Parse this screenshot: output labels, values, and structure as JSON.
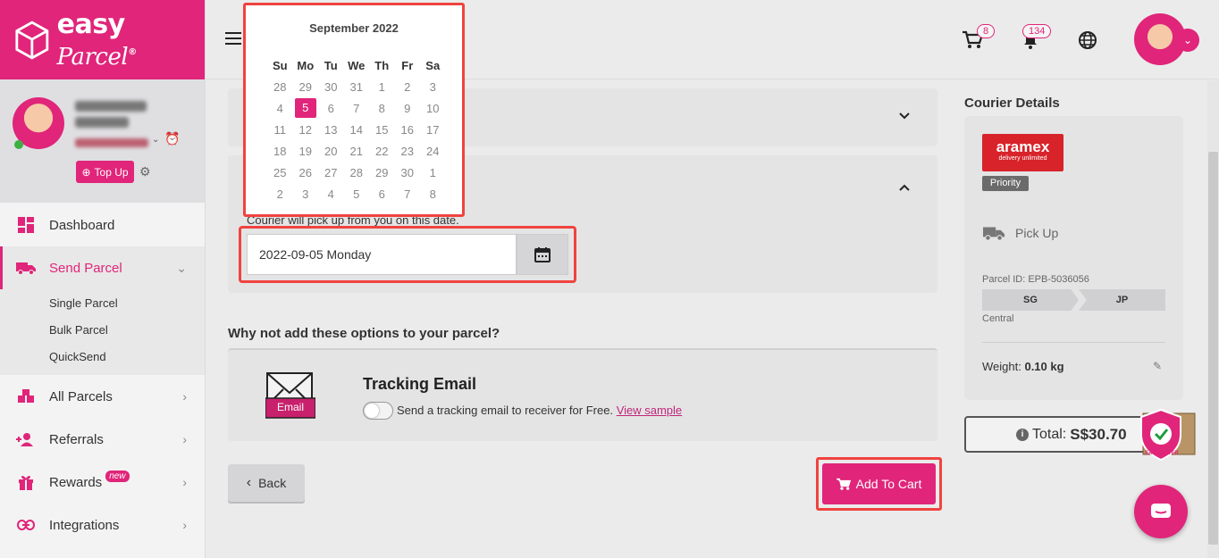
{
  "brand": {
    "name": "easy",
    "name_script": "Parcel",
    "mark": "®",
    "accent": "#e0257a"
  },
  "profile": {
    "topup_label": "Top Up"
  },
  "nav": {
    "dashboard": "Dashboard",
    "send_parcel": "Send Parcel",
    "sub": [
      "Single Parcel",
      "Bulk Parcel",
      "QuickSend"
    ],
    "all_parcels": "All Parcels",
    "referrals": "Referrals",
    "rewards": "Rewards",
    "rewards_badge": "new",
    "integrations": "Integrations"
  },
  "header": {
    "cart_count": "8",
    "notif_count": "134"
  },
  "calendar": {
    "title": "September 2022",
    "weekdays": [
      "Su",
      "Mo",
      "Tu",
      "We",
      "Th",
      "Fr",
      "Sa"
    ],
    "weeks": [
      [
        "28",
        "29",
        "30",
        "31",
        "1",
        "2",
        "3"
      ],
      [
        "4",
        "5",
        "6",
        "7",
        "8",
        "9",
        "10"
      ],
      [
        "11",
        "12",
        "13",
        "14",
        "15",
        "16",
        "17"
      ],
      [
        "18",
        "19",
        "20",
        "21",
        "22",
        "23",
        "24"
      ],
      [
        "25",
        "26",
        "27",
        "28",
        "29",
        "30",
        "1"
      ],
      [
        "2",
        "3",
        "4",
        "5",
        "6",
        "7",
        "8"
      ]
    ],
    "selected": "5"
  },
  "pickup": {
    "hint": "Courier will pick up from you on this date.",
    "date_value": "2022-09-05 Monday"
  },
  "options": {
    "title": "Why not add these options to your parcel?",
    "email_label": "Email",
    "tracking_title": "Tracking Email",
    "tracking_text": "Send a tracking email to receiver for Free.",
    "tracking_link": "View sample",
    "toggle_on": false
  },
  "actions": {
    "back": "Back",
    "add_to_cart": "Add To Cart"
  },
  "courier": {
    "title": "Courier Details",
    "brand": "aramex",
    "brand_tagline": "delivery unlimited",
    "tag": "Priority",
    "service": "Pick Up",
    "parcel_id": "Parcel ID: EPB-5036056",
    "from": "SG",
    "to": "JP",
    "region": "Central",
    "weight_label": "Weight:",
    "weight_value": "0.10 kg",
    "total_label": "Total:",
    "total_value": "S$30.70",
    "easycover_label": "EASYCOVER"
  }
}
